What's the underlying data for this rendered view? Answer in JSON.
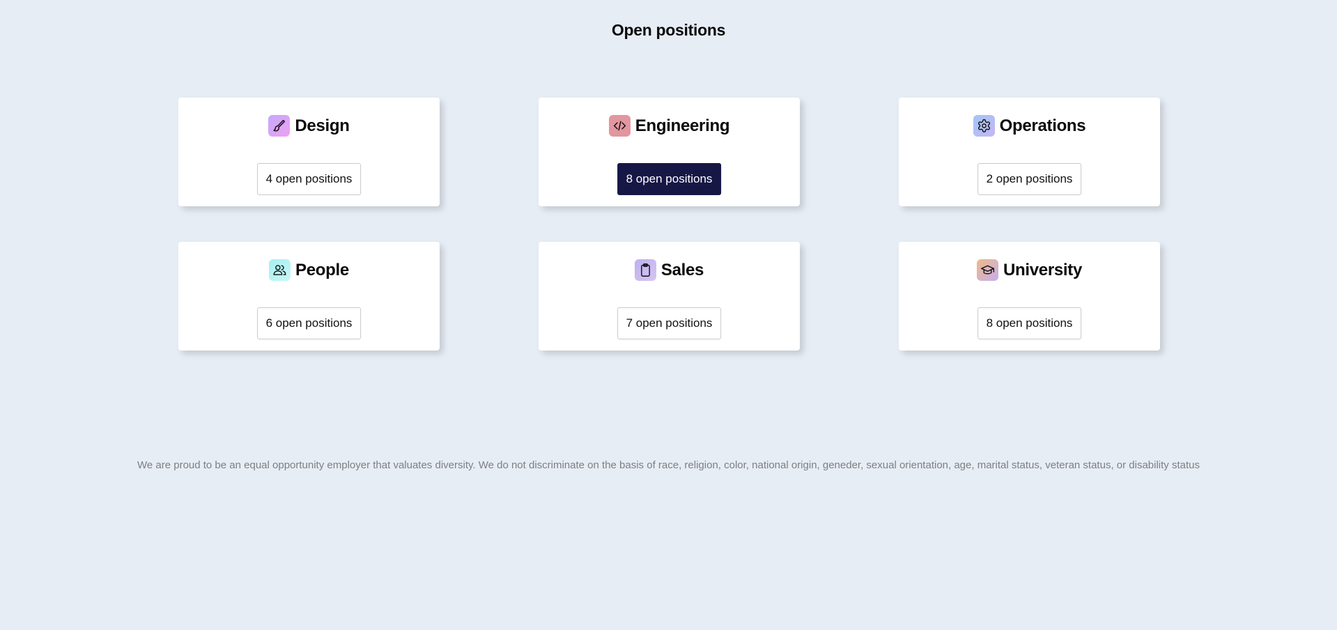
{
  "page": {
    "title": "Open positions"
  },
  "departments": [
    {
      "name": "Design",
      "button_label": "4 open positions",
      "icon": "paintbrush-icon",
      "gradient": [
        "#c4a9fb",
        "#f0a0f2"
      ],
      "active": false
    },
    {
      "name": "Engineering",
      "button_label": "8 open positions",
      "icon": "code-icon",
      "gradient": [
        "#e2969f",
        "#e2969f"
      ],
      "active": true
    },
    {
      "name": "Operations",
      "button_label": "2 open positions",
      "icon": "gear-icon",
      "gradient": [
        "#9fc7f5",
        "#c5b6f5"
      ],
      "active": false
    },
    {
      "name": "People",
      "button_label": "6 open positions",
      "icon": "users-icon",
      "gradient": [
        "#a6f0f2",
        "#c9f5f5"
      ],
      "active": false
    },
    {
      "name": "Sales",
      "button_label": "7 open positions",
      "icon": "clipboard-icon",
      "gradient": [
        "#bdb1ef",
        "#d6c4f3"
      ],
      "active": false
    },
    {
      "name": "University",
      "button_label": "8 open positions",
      "icon": "graduation-cap-icon",
      "gradient": [
        "#f0b985",
        "#c4aff0"
      ],
      "active": false
    }
  ],
  "footer": {
    "note": "We are proud to be an equal opportunity employer that valuates diversity. We do not discriminate on the basis of race, religion, color, national origin, geneder, sexual orientation, age, marital status, veteran status, or disability status"
  },
  "colors": {
    "background": "#e7edf5",
    "card": "#ffffff",
    "active_button": "#171746",
    "footer_text": "#7d7f84"
  }
}
